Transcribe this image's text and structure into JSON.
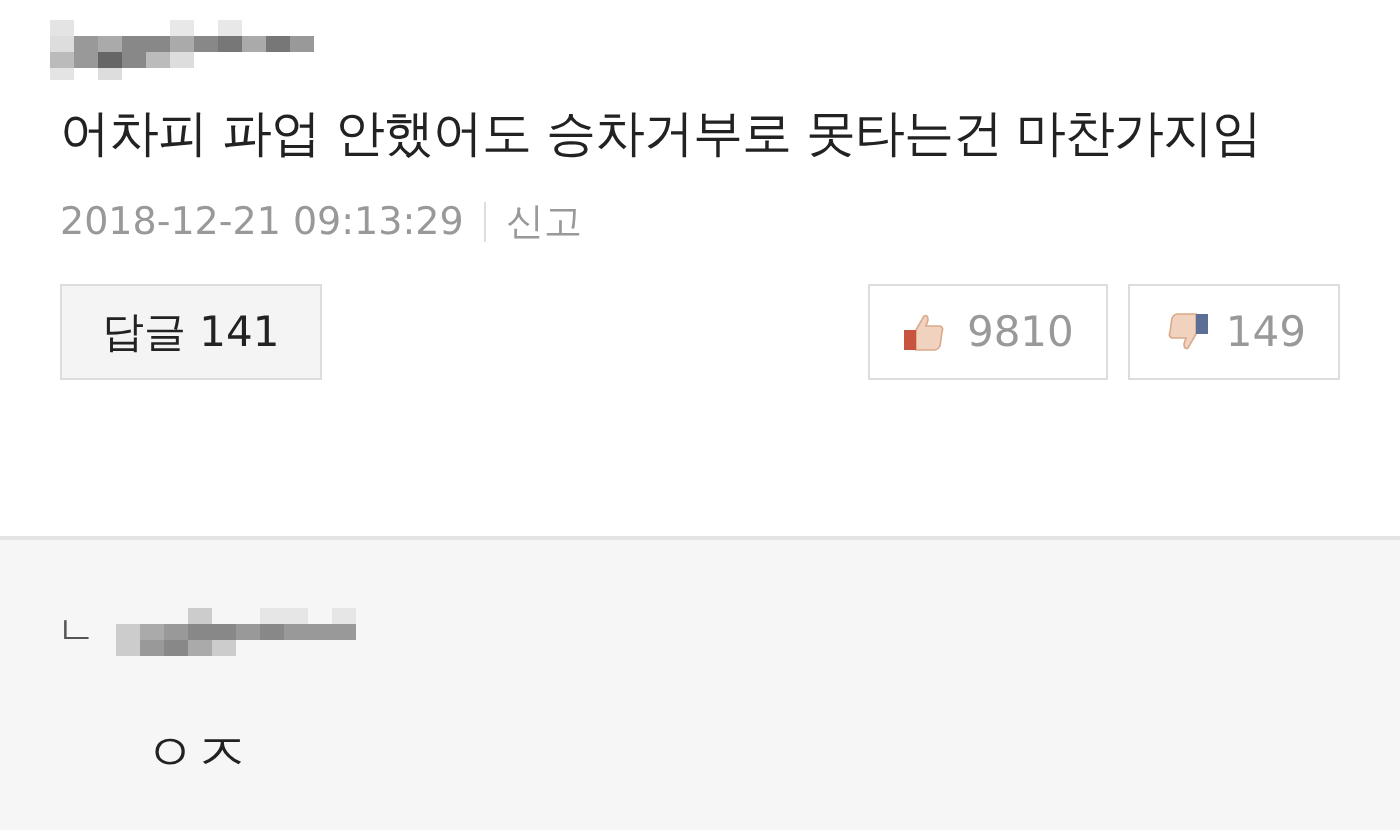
{
  "comment": {
    "text": "어차피 파업 안했어도 승차거부로 못타는건 마찬가지임",
    "date": "2018-12-21 09:13:29",
    "report": "신고",
    "reply_button": {
      "label": "답글",
      "count": "141"
    },
    "likes": "9810",
    "dislikes": "149"
  },
  "reply": {
    "marker": "ㄴ",
    "text": "ㅇㅈ"
  }
}
